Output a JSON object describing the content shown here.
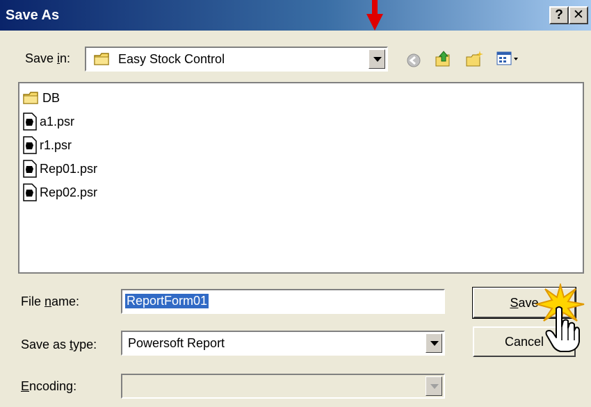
{
  "window": {
    "title": "Save As",
    "help_label": "?",
    "close_label": "✕"
  },
  "toolbar": {
    "save_in_label_pre": "Save ",
    "save_in_label_mnemonic": "i",
    "save_in_label_post": "n:",
    "current_folder": "Easy Stock Control",
    "icons": [
      "back-icon",
      "up-folder-icon",
      "new-folder-icon",
      "view-menu-icon"
    ]
  },
  "files": [
    {
      "name": "DB",
      "kind": "folder"
    },
    {
      "name": "a1.psr",
      "kind": "file"
    },
    {
      "name": "r1.psr",
      "kind": "file"
    },
    {
      "name": "Rep01.psr",
      "kind": "file"
    },
    {
      "name": "Rep02.psr",
      "kind": "file"
    }
  ],
  "form": {
    "file_name_pre": "File ",
    "file_name_mnemonic": "n",
    "file_name_post": "ame:",
    "file_name_value": "ReportForm01",
    "save_type_pre": "Save as ",
    "save_type_mnemonic": "t",
    "save_type_post": "ype:",
    "save_type_value": "Powersoft Report",
    "encoding_mnemonic": "E",
    "encoding_post": "ncoding:",
    "encoding_value": ""
  },
  "buttons": {
    "save_mnemonic": "S",
    "save_post": "ave",
    "cancel_label": "Cancel"
  },
  "colors": {
    "title_gradient_start": "#0a246a",
    "title_gradient_end": "#a6caf0",
    "dialog_bg": "#ece9d8",
    "selection": "#316ac5",
    "annotation_arrow": "#e00000"
  }
}
